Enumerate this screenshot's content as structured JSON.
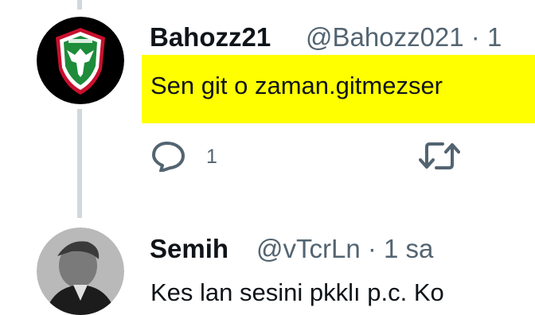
{
  "tweets": [
    {
      "name": "Bahozz21",
      "handle": "@Bahozz021 · 1",
      "text": "Sen git o zaman.gitmezser",
      "reply_count": "1"
    },
    {
      "name": "Semih",
      "handle": "@vTcrLn · 1 sa",
      "text": "Kes lan sesini pkklı p.c. Ko"
    }
  ],
  "icons": {
    "reply": "reply-icon",
    "retweet": "retweet-icon"
  },
  "colors": {
    "highlight": "#ffff00",
    "secondary_text": "#536471",
    "thread_line": "#cfd9de"
  }
}
